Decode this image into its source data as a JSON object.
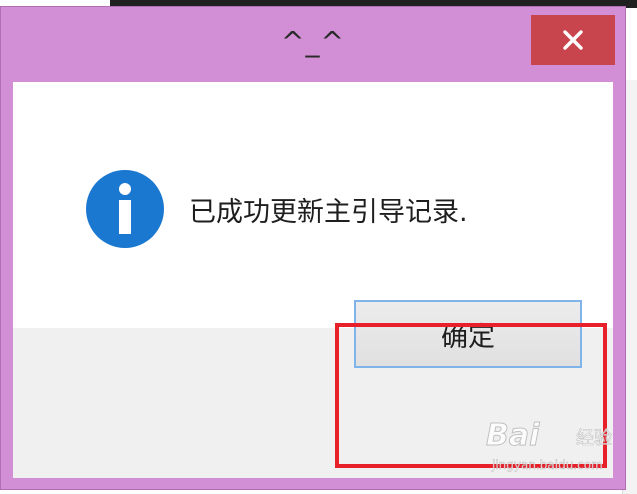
{
  "dialog": {
    "title": "^_^",
    "message": "已成功更新主引导记录.",
    "ok_label": "确定",
    "close_icon": "close-icon",
    "info_icon": "info-icon"
  },
  "colors": {
    "frame": "#d38fd6",
    "close_button": "#c8454e",
    "info_blue": "#1b78d0",
    "highlight": "#e8202a",
    "button_border": "#7eb4ea"
  },
  "watermark": {
    "brand": "Bai",
    "sub": "经验",
    "url": "jingyan.baidu.com"
  }
}
